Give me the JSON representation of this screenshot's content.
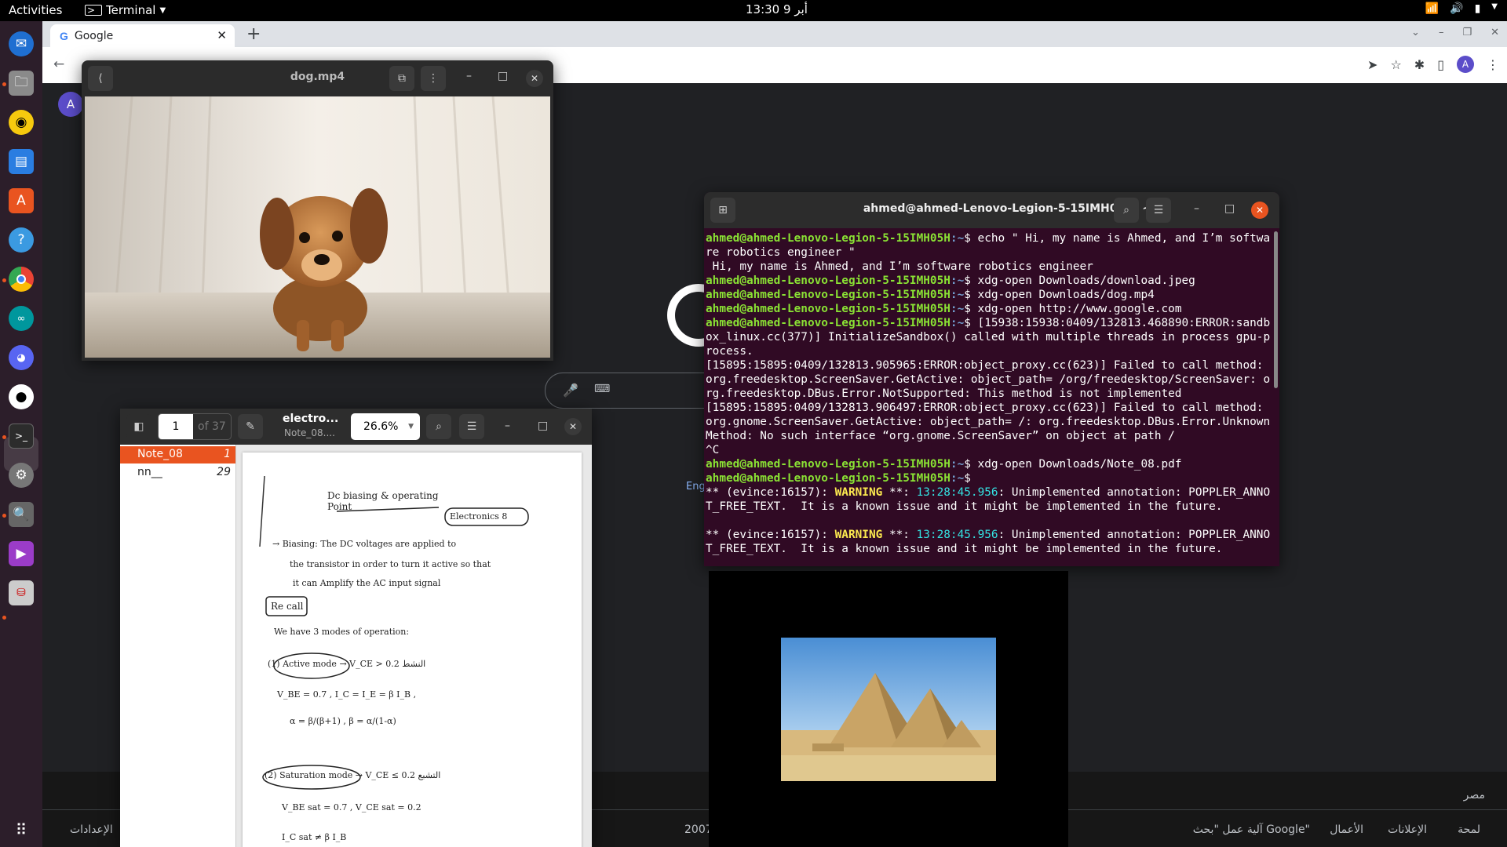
{
  "topbar": {
    "activities": "Activities",
    "app_name": "Terminal",
    "clock": "أبر 9  13:30"
  },
  "dock": {
    "items": [
      "thunderbird-icon",
      "files-icon",
      "rhythmbox-icon",
      "writer-icon",
      "software-icon",
      "help-icon",
      "chrome-icon",
      "arduino-icon",
      "discord-icon",
      "github-icon",
      "terminal-icon",
      "settings-icon",
      "search-icon",
      "videos-icon",
      "remote-icon"
    ]
  },
  "chrome": {
    "tab_title": "Google",
    "page_avatar": "A",
    "profile_avatar": "A",
    "eng_link": "Eng",
    "footer": {
      "country": "مصر",
      "items": [
        "لمحة",
        "الإعلانات",
        "الأعمال",
        "آلية عمل \"بحث Google\"",
        "2007",
        "الإعدادات"
      ]
    }
  },
  "video": {
    "title": "dog.mp4"
  },
  "pdf": {
    "page": "1",
    "of": "of 37",
    "title": "electro...",
    "subtitle": "Note_08....",
    "zoom": "26.6%",
    "outline": [
      {
        "label": "Note_08",
        "page": "1"
      },
      {
        "label": "nn__",
        "page": "29"
      }
    ],
    "handwriting": {
      "title": "Dc biasing & operating Point",
      "box": "Electronics 8",
      "lines": [
        "→ Biasing: The DC voltages are applied to",
        "the transistor in order to turn it active so that",
        "it can Amplify the AC input signal",
        "Re call",
        "We have 3 modes of operation:",
        "(1) Active mode  →  V_CE > 0.2  النشط",
        "V_BE = 0.7 ,  I_C = I_E = β I_B ,",
        "α = β/(β+1) ,  β = α/(1-α)",
        "(2) Saturation mode  →  V_CE ≤ 0.2  التشبع",
        "V_BE sat = 0.7 ,  V_CE sat = 0.2",
        "I_C sat ≠ β I_B"
      ]
    }
  },
  "terminal": {
    "title": "ahmed@ahmed-Lenovo-Legion-5-15IMH05H: ~",
    "prompt_user": "ahmed@ahmed-Lenovo-Legion-5-15IMH05H",
    "prompt_path": ":~",
    "cmd1": "$ echo \" Hi, my name is Ahmed, and I’m software robotics engineer \"",
    "out1": " Hi, my name is Ahmed, and I’m software robotics engineer",
    "cmd2": "$ xdg-open Downloads/download.jpeg",
    "cmd3": "$ xdg-open Downloads/dog.mp4",
    "cmd4": "$ xdg-open http://www.google.com",
    "cmd5": "$ [15938:15938:0409/132813.468890:ERROR:sandbox_linux.cc(377)] InitializeSandbox() called with multiple threads in process gpu-process.",
    "err1": "[15895:15895:0409/132813.905965:ERROR:object_proxy.cc(623)] Failed to call method: org.freedesktop.ScreenSaver.GetActive: object_path= /org/freedesktop/ScreenSaver: org.freedesktop.DBus.Error.NotSupported: This method is not implemented",
    "err2": "[15895:15895:0409/132813.906497:ERROR:object_proxy.cc(623)] Failed to call method: org.gnome.ScreenSaver.GetActive: object_path= /: org.freedesktop.DBus.Error.UnknownMethod: No such interface “org.gnome.ScreenSaver” on object at path /",
    "ctrl_c": "^C",
    "cmd6": "$ xdg-open Downloads/Note_08.pdf",
    "cmd7": "$",
    "warn_prefix": "** (evince:16157): ",
    "warn_word": "WARNING",
    "warn_mid": " **: ",
    "warn_time": "13:28:45.956",
    "warn_msg": ": Unimplemented annotation: POPPLER_ANNOT_FREE_TEXT.  It is a known issue and it might be implemented in the future."
  }
}
